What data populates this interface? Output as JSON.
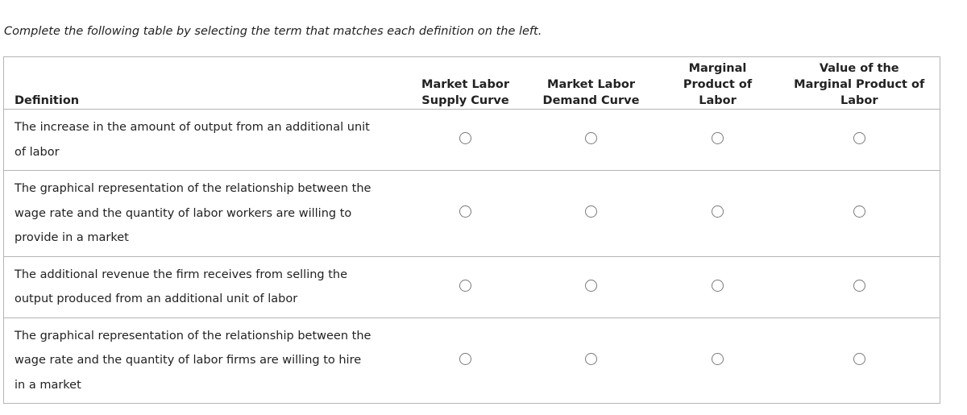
{
  "instructions": "Complete the following table by selecting the term that matches each definition on the left.",
  "table": {
    "headers": {
      "definition": "Definition",
      "options": [
        [
          "Market Labor",
          "Supply Curve"
        ],
        [
          "Market Labor",
          "Demand Curve"
        ],
        [
          "Marginal",
          "Product of",
          "Labor"
        ],
        [
          "Value of the",
          "Marginal Product of",
          "Labor"
        ]
      ]
    },
    "rows": [
      {
        "lines": [
          "The increase in the amount of output from an additional unit",
          "of labor"
        ],
        "selected": null
      },
      {
        "lines": [
          "The graphical representation of the relationship between the",
          "wage rate and the quantity of labor workers are willing to",
          "provide in a market"
        ],
        "selected": null
      },
      {
        "lines": [
          "The additional revenue the firm receives from selling the",
          "output produced from an additional unit of labor"
        ],
        "selected": null
      },
      {
        "lines": [
          "The graphical representation of the relationship between the",
          "wage rate and the quantity of labor firms are willing to hire",
          "in a market"
        ],
        "selected": null
      }
    ]
  }
}
